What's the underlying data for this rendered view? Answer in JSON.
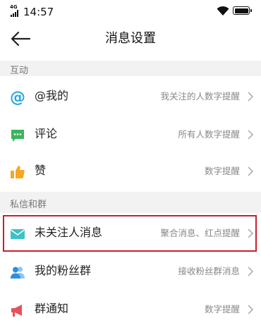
{
  "status_bar": {
    "network": "4G",
    "time": "14:57"
  },
  "header": {
    "title": "消息设置"
  },
  "sections": [
    {
      "title": "互动",
      "items": [
        {
          "label": "@我的",
          "detail": "我关注的人数字提醒",
          "icon": "at-icon",
          "color": "#2aa7dd"
        },
        {
          "label": "评论",
          "detail": "所有人数字提醒",
          "icon": "comment-icon",
          "color": "#3bb55d"
        },
        {
          "label": "赞",
          "detail": "数字提醒",
          "icon": "thumbs-up-icon",
          "color": "#f5a623"
        }
      ]
    },
    {
      "title": "私信和群",
      "items": [
        {
          "label": "未关注人消息",
          "detail": "聚合消息、红点提醒",
          "icon": "envelope-icon",
          "color": "#3cc2c6"
        },
        {
          "label": "我的粉丝群",
          "detail": "接收粉丝群消息",
          "icon": "group-icon",
          "color": "#2e8ee0"
        },
        {
          "label": "群通知",
          "detail": "数字提醒",
          "icon": "megaphone-icon",
          "color": "#e9505a"
        }
      ]
    }
  ],
  "highlight_color": "#c8202c"
}
